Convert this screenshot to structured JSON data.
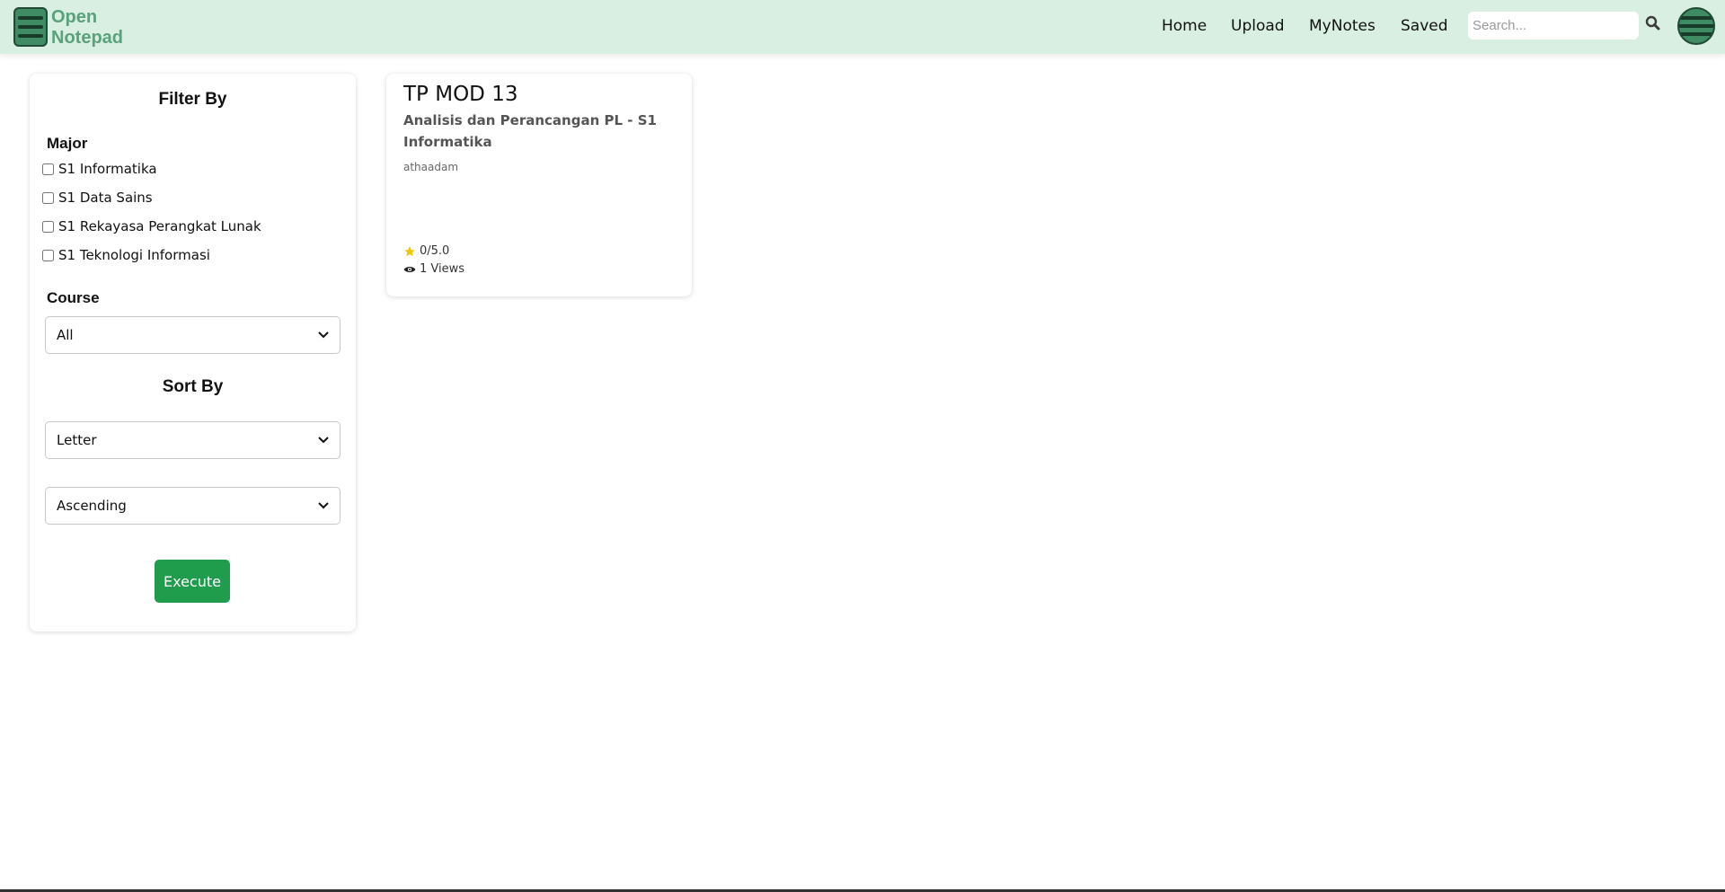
{
  "nav": {
    "brand_line1": "Open",
    "brand_line2": "Notepad",
    "links": [
      "Home",
      "Upload",
      "MyNotes",
      "Saved"
    ],
    "search_placeholder": "Search...",
    "bg_color": "#d8efe1",
    "accent_color": "#3f8b63"
  },
  "filter": {
    "title": "Filter By",
    "major_label": "Major",
    "majors": [
      "S1 Informatika",
      "S1 Data Sains",
      "S1 Rekayasa Perangkat Lunak",
      "S1 Teknologi Informasi"
    ],
    "course_label": "Course",
    "course_value": "All",
    "sort_title": "Sort By",
    "sort_field_value": "Letter",
    "sort_order_value": "Ascending",
    "execute_label": "Execute",
    "execute_color": "#1f9d4d"
  },
  "notes": [
    {
      "title": "TP MOD 13",
      "subtitle": "Analisis dan Perancangan PL - S1 Informatika",
      "author": "athaadam",
      "rating": "0/5.0",
      "views": "1 Views"
    }
  ],
  "icons": {
    "menu": "hamburger-icon",
    "search": "search-icon",
    "profile": "profile-menu-icon",
    "rating": "star-icon",
    "views": "eye-icon"
  }
}
